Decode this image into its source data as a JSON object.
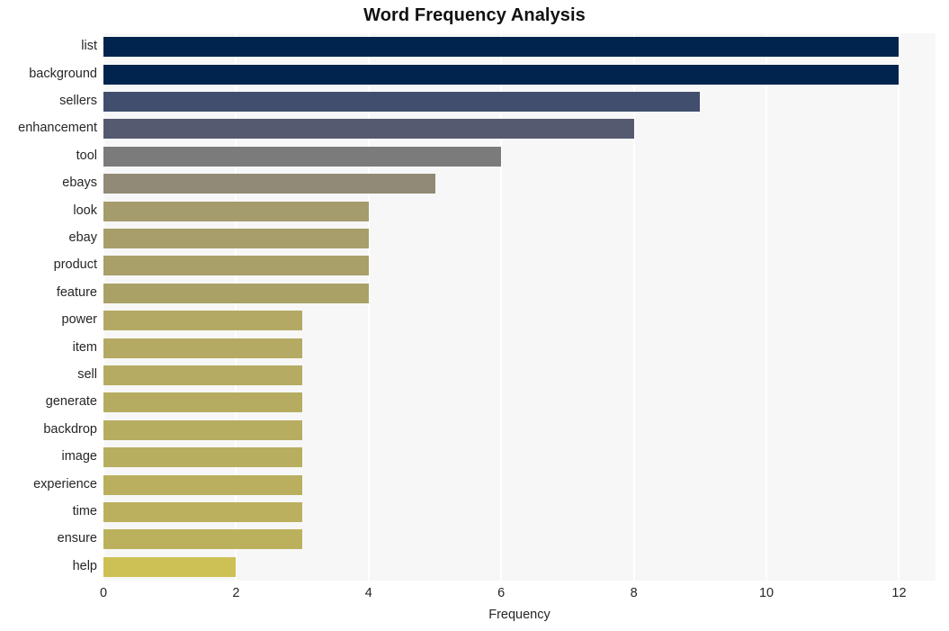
{
  "chart_data": {
    "type": "bar",
    "orientation": "horizontal",
    "title": "Word Frequency Analysis",
    "xlabel": "Frequency",
    "ylabel": "",
    "xlim": [
      0,
      12.55
    ],
    "xticks": [
      0,
      2,
      4,
      6,
      8,
      10,
      12
    ],
    "xtick_labels": [
      "0",
      "2",
      "4",
      "6",
      "8",
      "10",
      "12"
    ],
    "grid": "vertical",
    "legend": "none",
    "categories": [
      "list",
      "background",
      "sellers",
      "enhancement",
      "tool",
      "ebays",
      "look",
      "ebay",
      "product",
      "feature",
      "power",
      "item",
      "sell",
      "generate",
      "backdrop",
      "image",
      "experience",
      "time",
      "ensure",
      "help"
    ],
    "values": [
      12,
      12,
      9,
      8,
      6,
      5,
      4,
      4,
      4,
      4,
      3,
      3,
      3,
      3,
      3,
      3,
      3,
      3,
      3,
      2
    ],
    "bar_colors": [
      "#01244e",
      "#01244e",
      "#414e6e",
      "#565a70",
      "#7b7b7b",
      "#908a76",
      "#a59c6d",
      "#a79e6b",
      "#a99f69",
      "#aaa167",
      "#b3a964",
      "#b4aa63",
      "#b5ab62",
      "#b6ac61",
      "#b7ad60",
      "#b8ae5f",
      "#b9af5e",
      "#bab05d",
      "#bbb15c",
      "#cdc054"
    ],
    "plot_background": "#f7f7f7",
    "gridline_color": "#ffffff",
    "figure_background": "#ffffff",
    "text_color": "#262626"
  }
}
